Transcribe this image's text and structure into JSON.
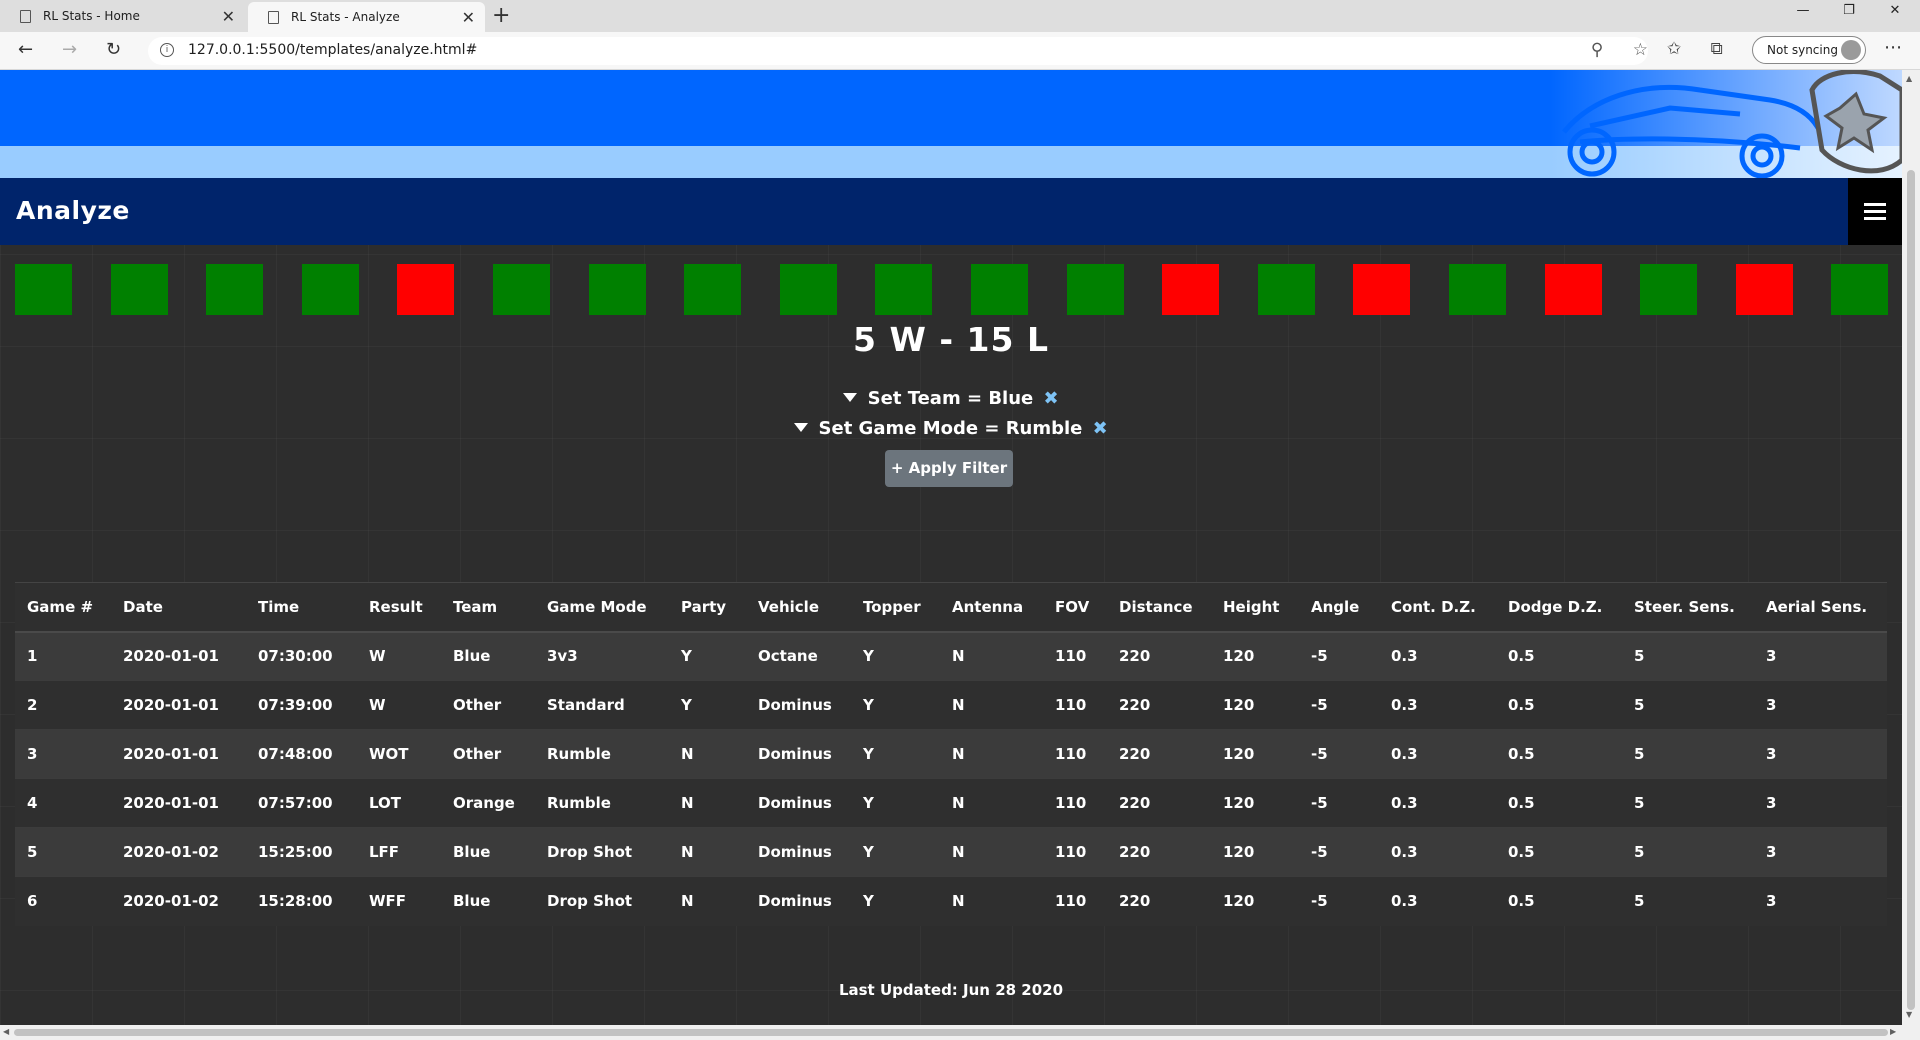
{
  "browser": {
    "tabs": [
      {
        "title": "RL Stats - Home",
        "active": false
      },
      {
        "title": "RL Stats - Analyze",
        "active": true
      }
    ],
    "url": "127.0.0.1:5500/templates/analyze.html#",
    "sync_label": "Not syncing"
  },
  "page": {
    "title": "Analyze",
    "colors": {
      "banner": "#0066ff",
      "banner_light": "#99ccff",
      "titlebar": "#00246b",
      "win": "#008000",
      "loss": "#ff0000"
    },
    "streak": [
      "W",
      "W",
      "W",
      "W",
      "L",
      "W",
      "W",
      "W",
      "W",
      "W",
      "W",
      "W",
      "L",
      "W",
      "L",
      "W",
      "L",
      "W",
      "L",
      "W"
    ],
    "record": "5 W - 15 L",
    "filters": [
      {
        "label": "Set Team = Blue"
      },
      {
        "label": "Set Game Mode = Rumble"
      }
    ],
    "apply_filter_label": "+ Apply Filter",
    "footer": "Last Updated: Jun 28 2020"
  },
  "table": {
    "headers": [
      "Game #",
      "Date",
      "Time",
      "Result",
      "Team",
      "Game Mode",
      "Party",
      "Vehicle",
      "Topper",
      "Antenna",
      "FOV",
      "Distance",
      "Height",
      "Angle",
      "Cont. D.Z.",
      "Dodge D.Z.",
      "Steer. Sens.",
      "Aerial Sens."
    ],
    "rows": [
      [
        "1",
        "2020-01-01",
        "07:30:00",
        "W",
        "Blue",
        "3v3",
        "Y",
        "Octane",
        "Y",
        "N",
        "110",
        "220",
        "120",
        "-5",
        "0.3",
        "0.5",
        "5",
        "3"
      ],
      [
        "2",
        "2020-01-01",
        "07:39:00",
        "W",
        "Other",
        "Standard",
        "Y",
        "Dominus",
        "Y",
        "N",
        "110",
        "220",
        "120",
        "-5",
        "0.3",
        "0.5",
        "5",
        "3"
      ],
      [
        "3",
        "2020-01-01",
        "07:48:00",
        "WOT",
        "Other",
        "Rumble",
        "N",
        "Dominus",
        "Y",
        "N",
        "110",
        "220",
        "120",
        "-5",
        "0.3",
        "0.5",
        "5",
        "3"
      ],
      [
        "4",
        "2020-01-01",
        "07:57:00",
        "LOT",
        "Orange",
        "Rumble",
        "N",
        "Dominus",
        "Y",
        "N",
        "110",
        "220",
        "120",
        "-5",
        "0.3",
        "0.5",
        "5",
        "3"
      ],
      [
        "5",
        "2020-01-02",
        "15:25:00",
        "LFF",
        "Blue",
        "Drop Shot",
        "N",
        "Dominus",
        "Y",
        "N",
        "110",
        "220",
        "120",
        "-5",
        "0.3",
        "0.5",
        "5",
        "3"
      ],
      [
        "6",
        "2020-01-02",
        "15:28:00",
        "WFF",
        "Blue",
        "Drop Shot",
        "N",
        "Dominus",
        "Y",
        "N",
        "110",
        "220",
        "120",
        "-5",
        "0.3",
        "0.5",
        "5",
        "3"
      ]
    ]
  }
}
